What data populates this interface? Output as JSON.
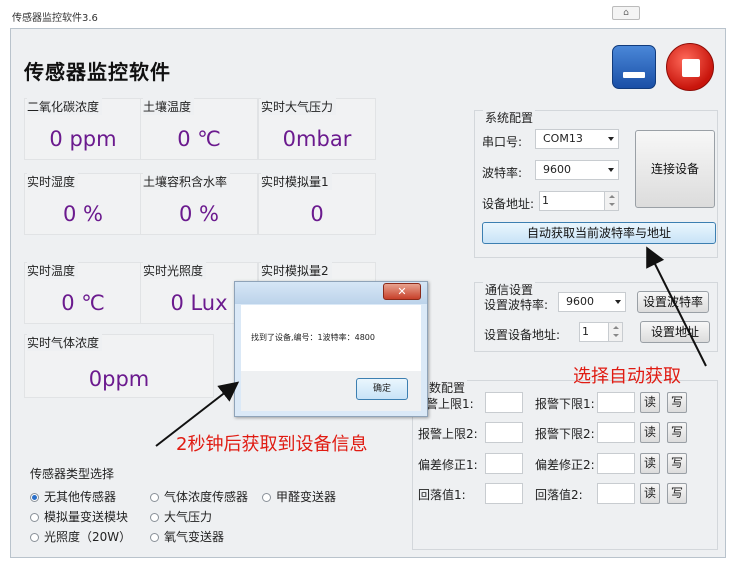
{
  "window": {
    "title": "传感器监控软件3.6",
    "app_title": "传感器监控软件",
    "title_btn": "⌂"
  },
  "readings": [
    {
      "label": "二氧化碳浓度",
      "value": "0 ppm"
    },
    {
      "label": "土壤温度",
      "value": "0 ℃"
    },
    {
      "label": "实时大气压力",
      "value": "0mbar"
    },
    {
      "label": "实时湿度",
      "value": "0 %"
    },
    {
      "label": "土壤容积含水率",
      "value": "0 %"
    },
    {
      "label": "实时模拟量1",
      "value": "0"
    },
    {
      "label": "实时温度",
      "value": "0 ℃"
    },
    {
      "label": "实时光照度",
      "value": "0 Lux"
    },
    {
      "label": "实时模拟量2",
      "value": ""
    },
    {
      "label": "实时气体浓度",
      "value": "0ppm"
    }
  ],
  "system_config": {
    "title": "系统配置",
    "port_label": "串口号:",
    "port_value": "COM13",
    "baud_label": "波特率:",
    "baud_value": "9600",
    "addr_label": "设备地址:",
    "addr_value": "1",
    "connect_button": "连接设备",
    "auto_button": "自动获取当前波特率与地址"
  },
  "comm_settings": {
    "title": "通信设置",
    "set_baud_label": "设置波特率:",
    "set_baud_value": "9600",
    "set_baud_button": "设置波特率",
    "set_addr_label": "设置设备地址:",
    "set_addr_value": "1",
    "set_addr_button": "设置地址"
  },
  "param_config": {
    "title": "参数配置",
    "title_visible": "数配置",
    "rows": [
      {
        "left": "报警上限1:",
        "right": "报警下限1:"
      },
      {
        "left": "报警上限2:",
        "right": "报警下限2:"
      },
      {
        "left": "偏差修正1:",
        "right": "偏差修正2:"
      },
      {
        "left": "回落值1:",
        "right": "回落值2:"
      }
    ],
    "row0_left_visible": "警上限1:",
    "read_button": "读",
    "write_button": "写"
  },
  "sensor_type": {
    "title": "传感器类型选择",
    "options": [
      "无其他传感器",
      "气体浓度传感器",
      "甲醛变送器",
      "模拟量变送模块",
      "大气压力",
      "光照度（20W）",
      "氧气变送器"
    ],
    "selected": "无其他传感器"
  },
  "dialog": {
    "message": "找到了设备,编号：1波特率：4800",
    "ok_button": "确定",
    "close_symbol": "✕"
  },
  "annotations": {
    "auto_get": "选择自动获取",
    "two_seconds": "2秒钟后获取到设备信息"
  },
  "colors": {
    "reading_value": "#6b1a8e",
    "annotation": "#e01b12",
    "window_bg": "#eef0f2"
  }
}
